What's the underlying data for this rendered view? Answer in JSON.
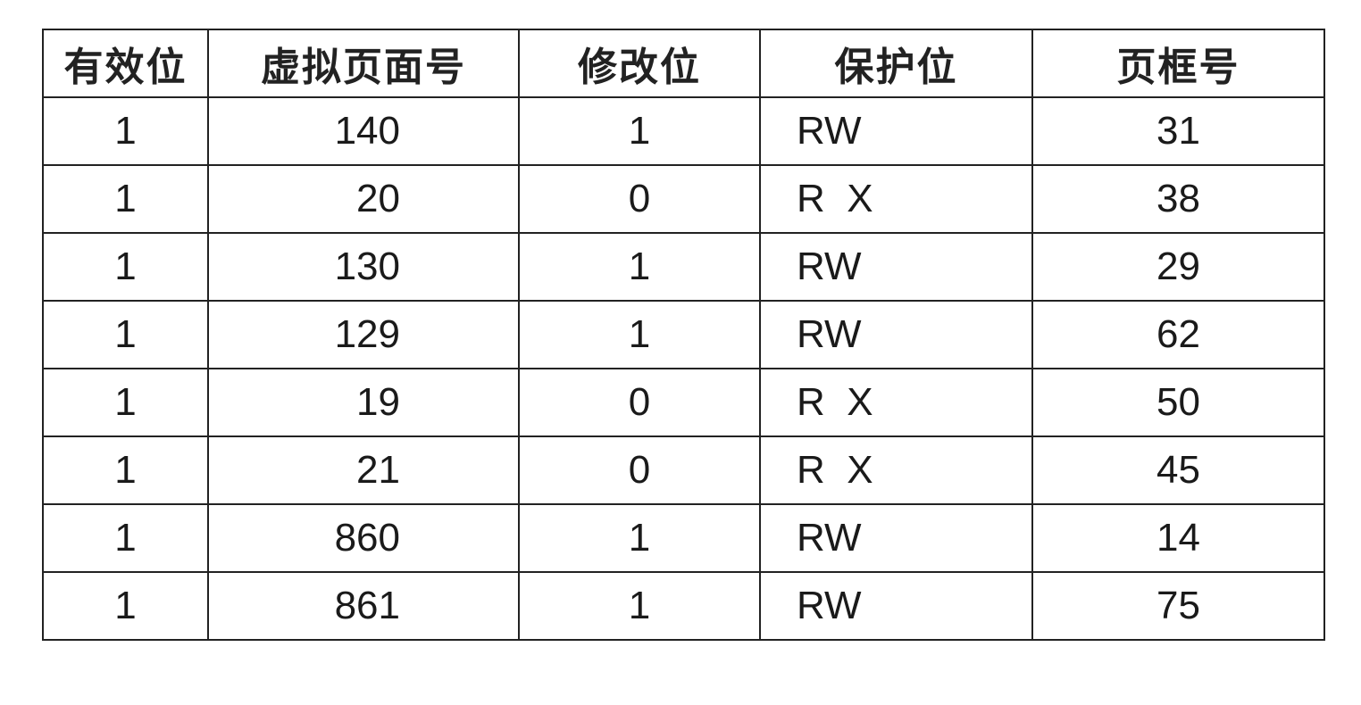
{
  "table": {
    "headers": [
      "有效位",
      "虚拟页面号",
      "修改位",
      "保护位",
      "页框号"
    ],
    "rows": [
      {
        "valid": "1",
        "virtual_page": "140",
        "modified": "1",
        "protection": "RW",
        "frame": "31"
      },
      {
        "valid": "1",
        "virtual_page": "20",
        "modified": "0",
        "protection": "R  X",
        "frame": "38"
      },
      {
        "valid": "1",
        "virtual_page": "130",
        "modified": "1",
        "protection": "RW",
        "frame": "29"
      },
      {
        "valid": "1",
        "virtual_page": "129",
        "modified": "1",
        "protection": "RW",
        "frame": "62"
      },
      {
        "valid": "1",
        "virtual_page": "19",
        "modified": "0",
        "protection": "R  X",
        "frame": "50"
      },
      {
        "valid": "1",
        "virtual_page": "21",
        "modified": "0",
        "protection": "R  X",
        "frame": "45"
      },
      {
        "valid": "1",
        "virtual_page": "860",
        "modified": "1",
        "protection": "RW",
        "frame": "14"
      },
      {
        "valid": "1",
        "virtual_page": "861",
        "modified": "1",
        "protection": "RW",
        "frame": "75"
      }
    ]
  }
}
